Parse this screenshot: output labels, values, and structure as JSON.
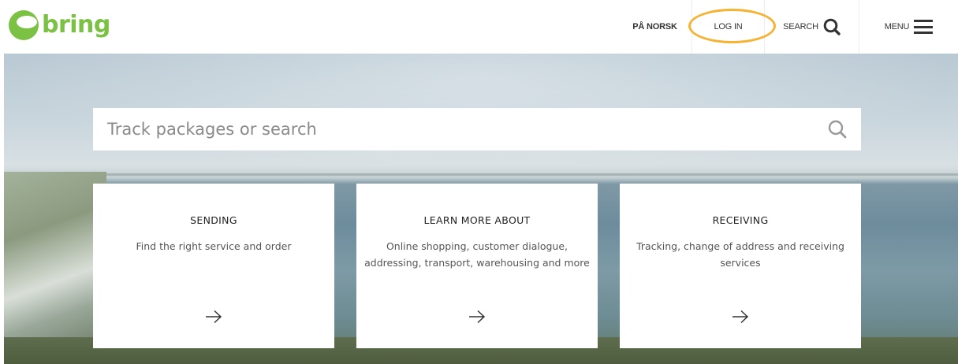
{
  "brand": {
    "name": "bring",
    "color": "#7bc144"
  },
  "nav": {
    "norsk": "PÅ NORSK",
    "login": "LOG IN",
    "search": "SEARCH",
    "menu": "MENU",
    "highlight_color": "#f5b335"
  },
  "search": {
    "placeholder": "Track packages or search",
    "icon": "search-icon"
  },
  "cards": [
    {
      "title": "SENDING",
      "description": "Find the right service and order",
      "icon": "arrow-right-icon"
    },
    {
      "title": "LEARN MORE ABOUT",
      "description": "Online shopping, customer dialogue, addressing, transport, warehousing and more",
      "icon": "arrow-right-icon"
    },
    {
      "title": "RECEIVING",
      "description": "Tracking, change of address and receiving services",
      "icon": "arrow-right-icon"
    }
  ]
}
